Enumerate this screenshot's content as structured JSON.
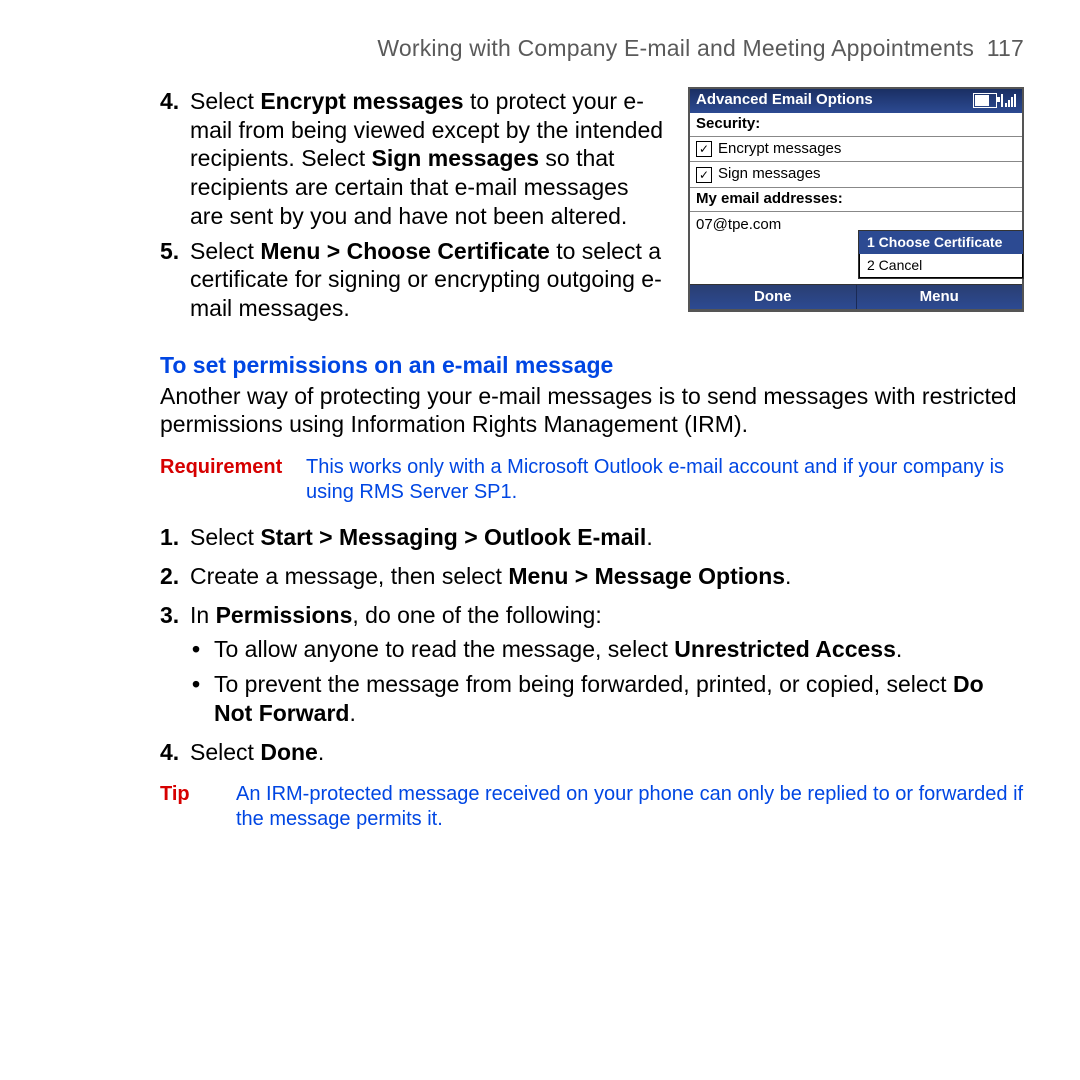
{
  "header": {
    "title": "Working with Company E-mail and Meeting Appointments",
    "page_number": "117"
  },
  "top_steps": {
    "s4": {
      "num": "4.",
      "p1": "Select ",
      "b1": "Encrypt messages",
      "p2": " to protect your e-mail from being viewed except by the intended recipients. Select ",
      "b2": "Sign messages",
      "p3": " so that recipients are certain that e-mail messages are sent by you and have not been altered."
    },
    "s5": {
      "num": "5.",
      "p1": "Select ",
      "b1": "Menu > Choose Certificate",
      "p2": " to select a certificate for signing or encrypting outgoing e-mail messages."
    }
  },
  "heading_permissions": "To set permissions on an e-mail message",
  "perm_intro": "Another way of protecting your e-mail messages is to send messages with restricted permissions using Information Rights Management (IRM).",
  "requirement": {
    "label": "Requirement",
    "text": "This works only with a Microsoft Outlook e-mail account and if your company is using RMS Server SP1."
  },
  "perm_steps": {
    "s1": {
      "num": "1.",
      "p1": "Select ",
      "b1": "Start > Messaging > Outlook E-mail",
      "p2": "."
    },
    "s2": {
      "num": "2.",
      "p1": "Create a message, then select ",
      "b1": "Menu > Message Options",
      "p2": "."
    },
    "s3": {
      "num": "3.",
      "p1": "In ",
      "b1": "Permissions",
      "p2": ", do one of the following:"
    },
    "b_a": {
      "p1": "To allow anyone to read the message, select ",
      "b1": "Unrestricted Access",
      "p2": "."
    },
    "b_b": {
      "p1": "To prevent the message from being forwarded, printed, or copied, select ",
      "b1": "Do Not Forward",
      "p2": "."
    },
    "s4": {
      "num": "4.",
      "p1": "Select ",
      "b1": "Done",
      "p2": "."
    }
  },
  "tip": {
    "label": "Tip",
    "text": "An IRM-protected message received on your phone can only be replied to or forwarded if the message permits it."
  },
  "device": {
    "title": "Advanced Email Options",
    "security_label": "Security:",
    "encrypt_label": "Encrypt messages",
    "sign_label": "Sign messages",
    "addresses_label": "My email addresses:",
    "email": "07@tpe.com",
    "menu_choose": "1 Choose Certificate",
    "menu_cancel": "2 Cancel",
    "soft_left": "Done",
    "soft_right": "Menu"
  }
}
